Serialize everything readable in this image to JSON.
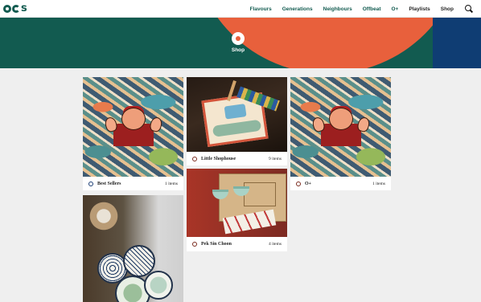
{
  "header": {
    "logo_label": "ocs",
    "nav": [
      {
        "label": "Flavours"
      },
      {
        "label": "Generations"
      },
      {
        "label": "Neighbours"
      },
      {
        "label": "Offbeat"
      },
      {
        "label": "O+"
      },
      {
        "label": "Playlists"
      },
      {
        "label": "Shop"
      }
    ],
    "search_icon": "search-icon"
  },
  "banner": {
    "title": "Shop",
    "icon": "shop-icon",
    "colors": {
      "left": "#125b50",
      "circle": "#e8603c",
      "right": "#0f3d73"
    }
  },
  "collections": [
    {
      "name": "Best Sellers",
      "count": "1 items",
      "icon": "collection-icon"
    },
    {
      "name": "Little Shophouse",
      "count": "9 items",
      "icon": "collection-icon"
    },
    {
      "name": "O+",
      "count": "1 items",
      "icon": "collection-icon"
    },
    {
      "name": "Pek Sin Choon",
      "count": "4 items",
      "icon": "collection-icon"
    }
  ]
}
